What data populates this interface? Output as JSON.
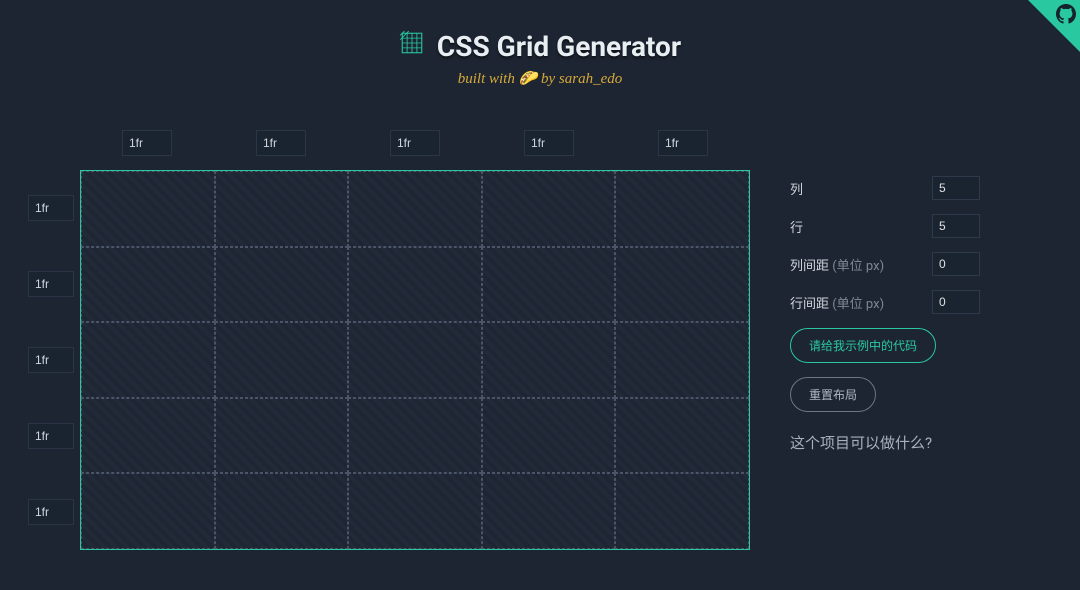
{
  "header": {
    "title": "CSS Grid Generator",
    "byline_prefix": "built with",
    "byline_emoji": "🌮",
    "byline_suffix": " by sarah_edo"
  },
  "grid": {
    "columns": [
      "1fr",
      "1fr",
      "1fr",
      "1fr",
      "1fr"
    ],
    "rows": [
      "1fr",
      "1fr",
      "1fr",
      "1fr",
      "1fr"
    ]
  },
  "controls": {
    "columns": {
      "label": "列",
      "value": "5"
    },
    "rows": {
      "label": "行",
      "value": "5"
    },
    "col_gap": {
      "label": "列间距 ",
      "unit": "(单位 px)",
      "value": "0"
    },
    "row_gap": {
      "label": "行间距 ",
      "unit": "(单位 px)",
      "value": "0"
    }
  },
  "buttons": {
    "show_code": "请给我示例中的代码",
    "reset": "重置布局"
  },
  "about": {
    "link": "这个项目可以做什么?"
  }
}
